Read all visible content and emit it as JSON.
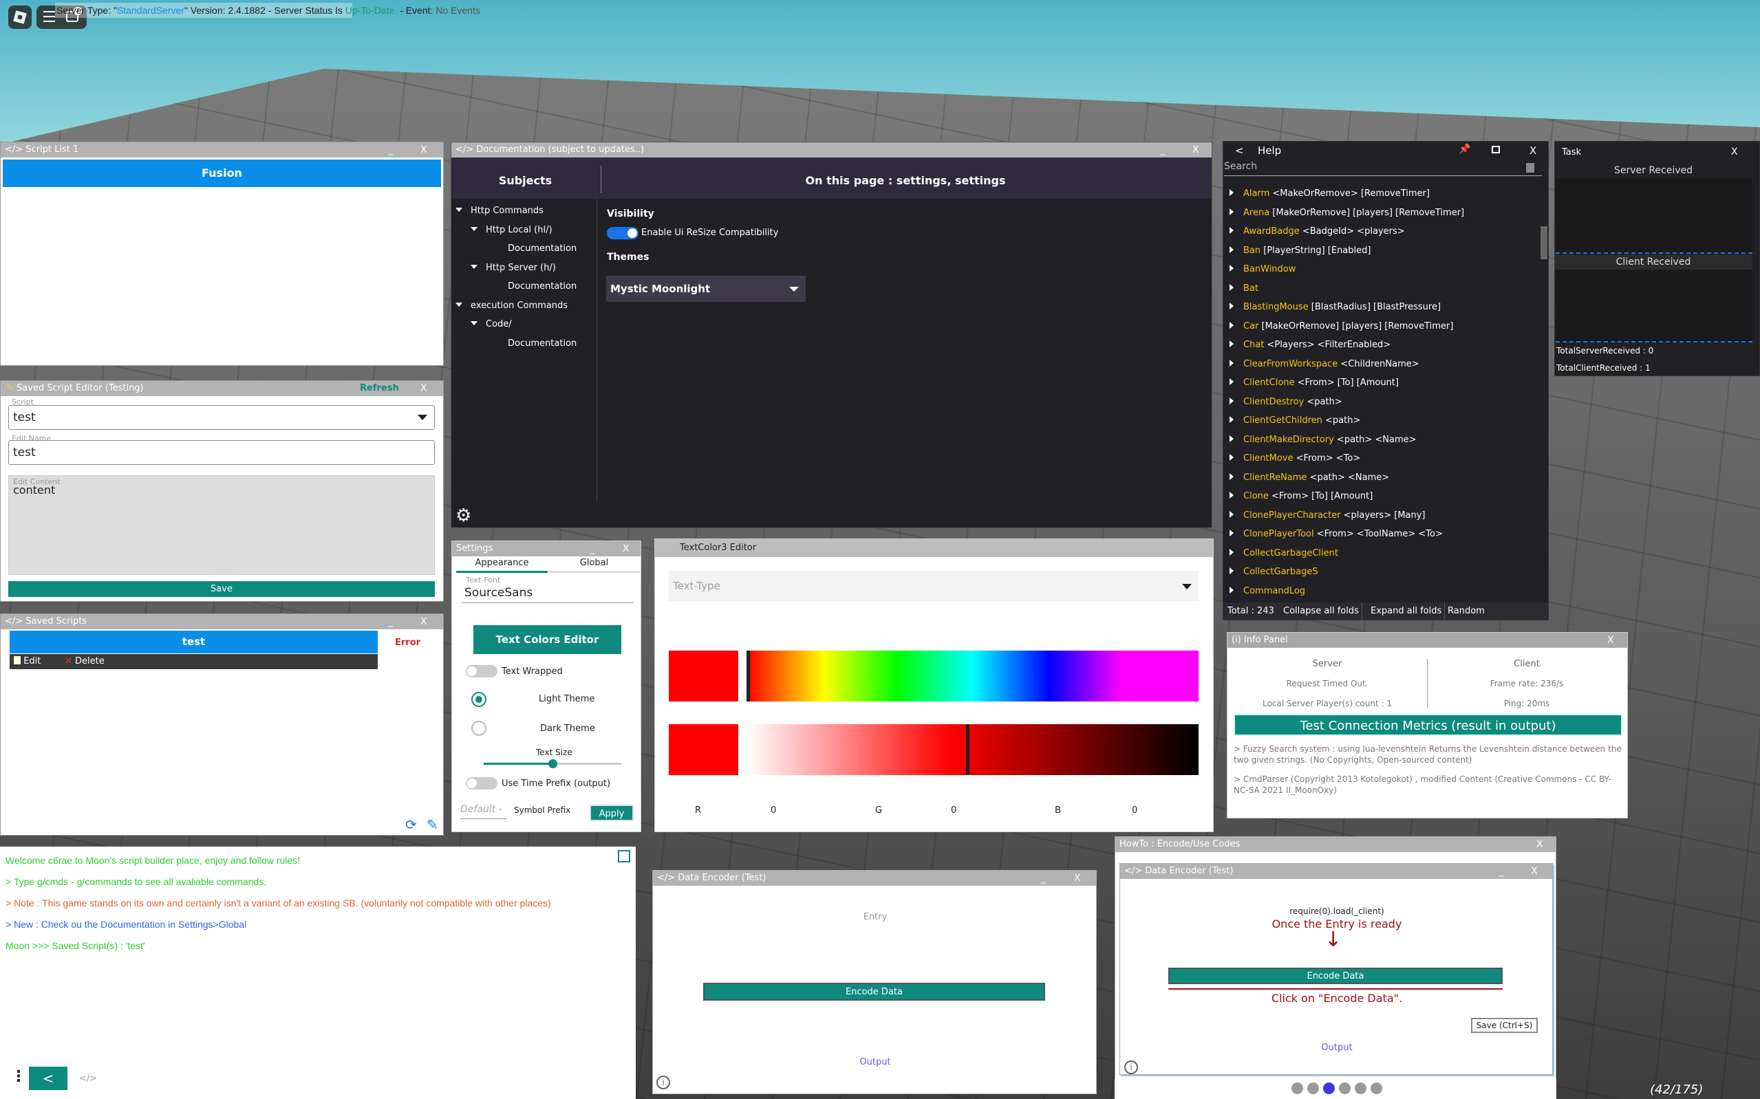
{
  "topbar": {
    "notif_count": "2",
    "server_prefix": "Server Type: \"",
    "server_type": "StandardServer",
    "server_mid": "\" Version: 2.4.1882 - Server Status Is ",
    "server_status": "Up-To-Date.",
    "server_event_label": " - Event: ",
    "server_event": "No Events"
  },
  "script_list": {
    "title": "</> Script List 1",
    "min": "_",
    "close": "X",
    "item": "Fusion"
  },
  "sse": {
    "title": "Saved Script Editor (Testing)",
    "refresh": "Refresh",
    "close": "X",
    "script_label": "Script",
    "script_value": "test",
    "edit_name_label": "Edit Name",
    "edit_name_value": "test",
    "content_label": "Edit Content",
    "content_value": "content",
    "save": "Save"
  },
  "saved": {
    "title": "</> Saved Scripts",
    "min": "_",
    "close": "X",
    "item": "test",
    "error": "Error",
    "edit": "Edit",
    "delete": "Delete"
  },
  "console": {
    "lines": [
      {
        "text": "Welcome c6rae to Moon's script builder place, enjoy and follow rules!",
        "color": "#2bd12b"
      },
      {
        "text": "> Type g/cmds - g/commands to see all avaliable commands.",
        "color": "#2bd12b"
      },
      {
        "text": "> Note : This game stands on its own and certainly isn't a variant of an existing SB. (voluntarily not compatible with other places)",
        "color": "#e0632f"
      },
      {
        "text": "> New : Check ou the Documentation in Settings>Global",
        "color": "#2a64e8"
      },
      {
        "text": "Moon >>> Saved Script(s) : 'test'",
        "color": "#2bd12b"
      }
    ],
    "back": "<",
    "code": "</>"
  },
  "doc": {
    "title": "</> Documentation (subject to updates..)",
    "min": "_",
    "close": "X",
    "subjects": "Subjects",
    "page_heading": "On this page : settings, settings",
    "tree": [
      {
        "label": "Http Commands",
        "level": 0
      },
      {
        "label": "Http Local (hl/)",
        "level": 1
      },
      {
        "label": "Documentation",
        "level": 2
      },
      {
        "label": "Http Server (h/)",
        "level": 1
      },
      {
        "label": "Documentation",
        "level": 2
      },
      {
        "label": "execution Commands",
        "level": 0
      },
      {
        "label": "Code/",
        "level": 1
      },
      {
        "label": "Documentation",
        "level": 2
      }
    ],
    "visibility": "Visibility",
    "toggle_label": "Enable Ui ReSize Compatibility",
    "themes": "Themes",
    "theme_value": "Mystic Moonlight"
  },
  "settings": {
    "title": "Settings",
    "min": "_",
    "close": "X",
    "tab_appearance": "Appearance",
    "tab_global": "Global",
    "font_label": "Text-Font",
    "font_value": "SourceSans",
    "colors_btn": "Text Colors Editor",
    "wrapped": "Text Wrapped",
    "light": "Light Theme",
    "dark": "Dark Theme",
    "text_size": "Text Size",
    "text_size_level": 0.5,
    "time_prefix": "Use Time Prefix (output)",
    "symbol_placeholder": "Default -",
    "symbol_prefix": "Symbol Prefix",
    "apply": "Apply"
  },
  "tc": {
    "title": "TextColor3 Editor",
    "type_placeholder": "Text-Type",
    "r_label": "R",
    "r": "0",
    "g_label": "G",
    "g": "0",
    "b_label": "B",
    "b": "0",
    "selected_color": "#ff0000"
  },
  "help": {
    "back": "<",
    "title": "Help",
    "close": "X",
    "search_placeholder": "Search",
    "items": [
      {
        "name": "Alarm",
        "args": "<MakeOrRemove> [RemoveTimer]"
      },
      {
        "name": "Arena",
        "args": "[MakeOrRemove] [players] [RemoveTimer]"
      },
      {
        "name": "AwardBadge",
        "args": "<BadgeId> <players>"
      },
      {
        "name": "Ban",
        "args": "[PlayerString] [Enabled]"
      },
      {
        "name": "BanWindow",
        "args": ""
      },
      {
        "name": "Bat",
        "args": ""
      },
      {
        "name": "BlastingMouse",
        "args": "[BlastRadius] [BlastPressure]"
      },
      {
        "name": "Car",
        "args": "[MakeOrRemove] [players] [RemoveTimer]"
      },
      {
        "name": "Chat",
        "args": "<Players> <FilterEnabled>"
      },
      {
        "name": "ClearFromWorkspace",
        "args": "<ChildrenName>"
      },
      {
        "name": "ClientClone",
        "args": "<From> [To] [Amount]"
      },
      {
        "name": "ClientDestroy",
        "args": "<path>"
      },
      {
        "name": "ClientGetChildren",
        "args": "<path>"
      },
      {
        "name": "ClientMakeDirectory",
        "args": "<path> <Name>"
      },
      {
        "name": "ClientMove",
        "args": "<From> <To>"
      },
      {
        "name": "ClientReName",
        "args": "<path> <Name>"
      },
      {
        "name": "Clone",
        "args": "<From> [To] [Amount]"
      },
      {
        "name": "ClonePlayerCharacter",
        "args": "<players> [Many]"
      },
      {
        "name": "ClonePlayerTool",
        "args": "<From> <ToolName> <To>"
      },
      {
        "name": "CollectGarbageClient",
        "args": ""
      },
      {
        "name": "CollectGarbageS",
        "args": ""
      },
      {
        "name": "CommandLog",
        "args": ""
      }
    ],
    "total": "Total : 243",
    "collapse": "Collapse all folds",
    "expand": "Expand all folds",
    "random": "Random"
  },
  "task": {
    "title": "Task",
    "close": "X",
    "server_received": "Server Received",
    "client_received": "Client Received",
    "total_server": "TotalServerReceived : 0",
    "total_client": "TotalClientReceived : 1"
  },
  "info": {
    "title": "(i) Info Panel",
    "close": "X",
    "server": "Server",
    "client": "Client",
    "request": "Request Timed Out.",
    "frame": "Frame rate: 236/s",
    "local_count": "Local Server Player(s) count : 1",
    "ping": "Ping: 20ms",
    "test_btn": "Test Connection Metrics (result in output)",
    "note1": "> Fuzzy Search system : using lua-levenshtein Returns the Levenshtein distance between the two given strings. (No Copyrights, Open-sourced content)",
    "note2": "> CmdParser (Copyright 2013 Kotolegokot) , modified Content (Creative Commons - CC BY-NC-SA 2021 II_MoonOxy)"
  },
  "enc": {
    "title": "</> Data Encoder (Test)",
    "min": "_",
    "close": "X",
    "entry": "Entry",
    "encode": "Encode Data",
    "output": "Output"
  },
  "howto": {
    "title": "HowTo :  Encode/Use Codes",
    "close": "X",
    "inner_title": "</> Data Encoder (Test)",
    "min": "_",
    "close2": "X",
    "require": "require(0).load(_client)",
    "ready": "Once the Entry is ready",
    "encode": "Encode Data",
    "click": "Click on \"Encode Data\".",
    "save": "Save (Ctrl+S)",
    "output": "Output",
    "page": "(42/175)"
  },
  "colors": {
    "accent": "#0e8a7e",
    "blue": "#0a8fe8",
    "dark": "#212025"
  }
}
